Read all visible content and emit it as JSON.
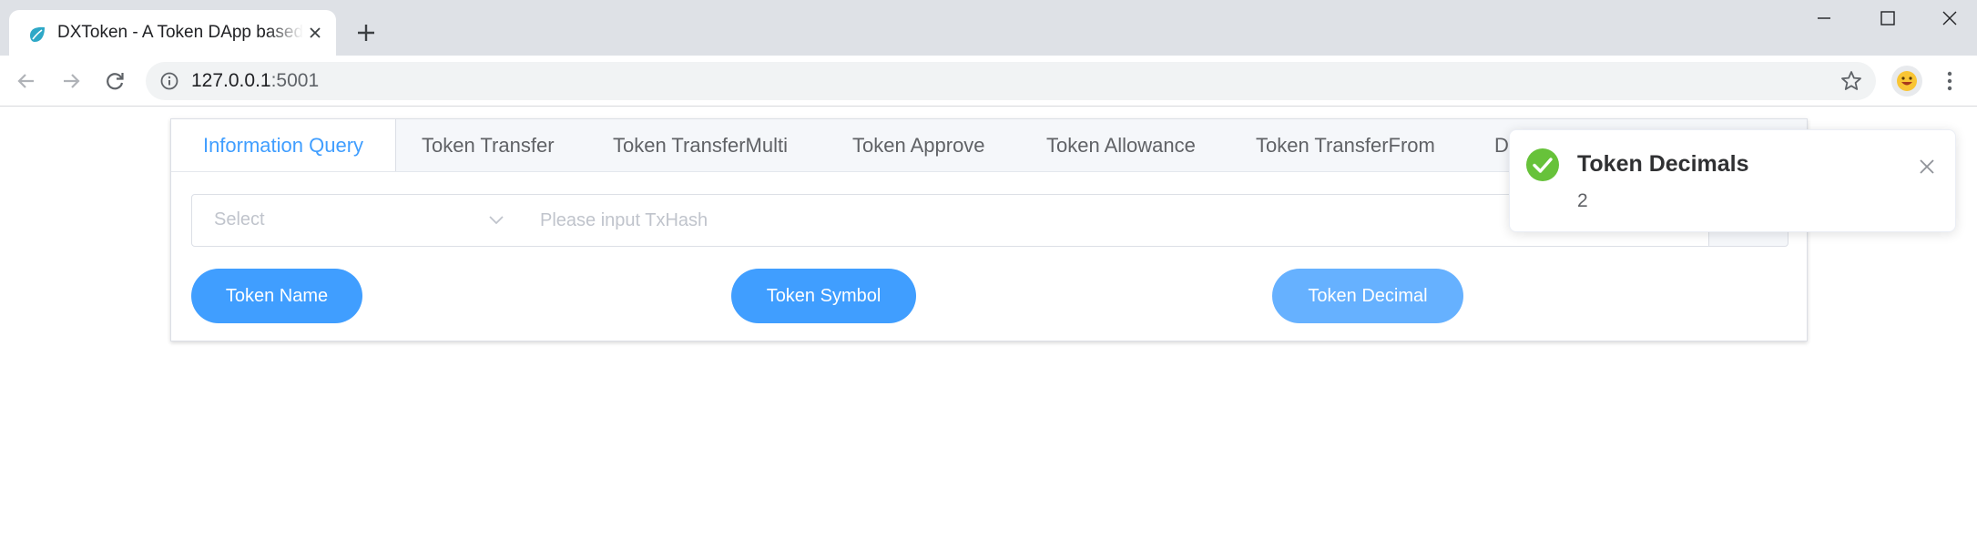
{
  "browser": {
    "tab_title": "DXToken - A Token DApp based",
    "url_host": "127.0.0.1",
    "url_port": ":5001",
    "icons": {
      "favicon": "leaf-icon",
      "tab_close": "close-icon",
      "new_tab": "plus-icon",
      "back": "arrow-left-icon",
      "forward": "arrow-right-icon",
      "reload": "reload-icon",
      "site_info": "info-icon",
      "bookmark": "star-icon",
      "profile": "emoji-avatar-icon",
      "menu": "kebab-menu-icon",
      "minimize": "minimize-icon",
      "maximize": "maximize-icon",
      "close": "close-icon"
    }
  },
  "tabs": [
    {
      "label": "Information Query",
      "active": true
    },
    {
      "label": "Token Transfer",
      "active": false
    },
    {
      "label": "Token TransferMulti",
      "active": false
    },
    {
      "label": "Token Approve",
      "active": false
    },
    {
      "label": "Token Allowance",
      "active": false
    },
    {
      "label": "Token TransferFrom",
      "active": false
    },
    {
      "label": "D",
      "active": false
    }
  ],
  "query": {
    "select_placeholder": "Select",
    "hash_placeholder": "Please input TxHash"
  },
  "buttons": {
    "token_name": "Token Name",
    "token_symbol": "Token Symbol",
    "token_decimal": "Token Decimal"
  },
  "notification": {
    "title": "Token Decimals",
    "message": "2",
    "icon": "success-check-icon"
  },
  "colors": {
    "primary": "#409eff",
    "primary_light": "#66b1ff",
    "success": "#67c23a",
    "tab_strip": "#dee1e6"
  }
}
